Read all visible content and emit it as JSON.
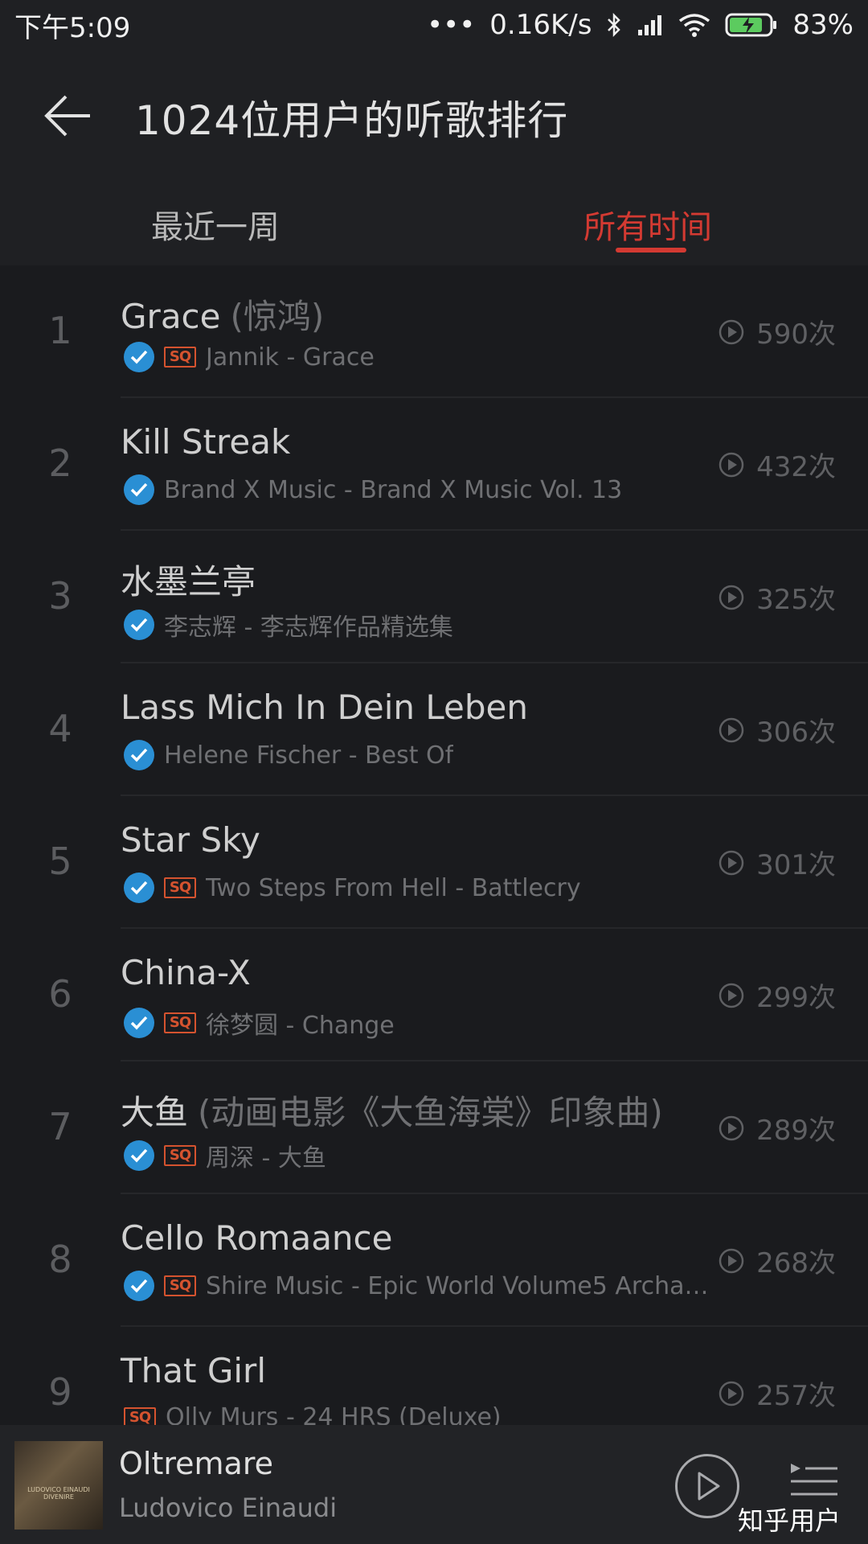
{
  "status_bar": {
    "time": "下午5:09",
    "dots": "•••",
    "speed": "0.16K/s",
    "battery": "83%",
    "icons": [
      "bluetooth-icon",
      "signal-icon",
      "wifi-icon",
      "battery-icon"
    ]
  },
  "header": {
    "title": "1024位用户的听歌排行",
    "tabs": [
      {
        "label": "最近一周",
        "active": false
      },
      {
        "label": "所有时间",
        "active": true
      }
    ]
  },
  "colors": {
    "accent": "#d33a32",
    "verified": "#2a8fd4",
    "sq": "#d5532f"
  },
  "songs": [
    {
      "rank": "1",
      "title": "Grace",
      "alias": "(惊鸿)",
      "verified": true,
      "sq": true,
      "subtitle": "Jannik - Grace",
      "count": "590次"
    },
    {
      "rank": "2",
      "title": "Kill Streak",
      "alias": "",
      "verified": true,
      "sq": false,
      "subtitle": "Brand X Music - Brand X Music Vol. 13",
      "count": "432次"
    },
    {
      "rank": "3",
      "title": "水墨兰亭",
      "alias": "",
      "verified": true,
      "sq": false,
      "subtitle": "李志辉 - 李志辉作品精选集",
      "count": "325次"
    },
    {
      "rank": "4",
      "title": "Lass Mich In Dein Leben",
      "alias": "",
      "verified": true,
      "sq": false,
      "subtitle": "Helene Fischer - Best Of",
      "count": "306次"
    },
    {
      "rank": "5",
      "title": "Star Sky",
      "alias": "",
      "verified": true,
      "sq": true,
      "subtitle": "Two Steps From Hell - Battlecry",
      "count": "301次"
    },
    {
      "rank": "6",
      "title": "China-X",
      "alias": "",
      "verified": true,
      "sq": true,
      "subtitle": "徐梦圆 - Change",
      "count": "299次"
    },
    {
      "rank": "7",
      "title": "大鱼",
      "alias": "(动画电影《大鱼海棠》印象曲)",
      "verified": true,
      "sq": true,
      "subtitle": "周深 - 大鱼",
      "count": "289次"
    },
    {
      "rank": "8",
      "title": "Cello Romaance",
      "alias": "",
      "verified": true,
      "sq": true,
      "subtitle": "Shire Music - Epic World Volume5 Archan...",
      "count": "268次"
    },
    {
      "rank": "9",
      "title": "That Girl",
      "alias": "",
      "verified": false,
      "sq": true,
      "subtitle": "Olly Murs - 24 HRS (Deluxe)",
      "count": "257次"
    }
  ],
  "sq_label": "SQ",
  "player": {
    "title": "Oltremare",
    "artist": "Ludovico Einaudi",
    "cover_text": "LUDOVICO EINAUDI DIVENIRE"
  },
  "watermark": "知乎用户"
}
